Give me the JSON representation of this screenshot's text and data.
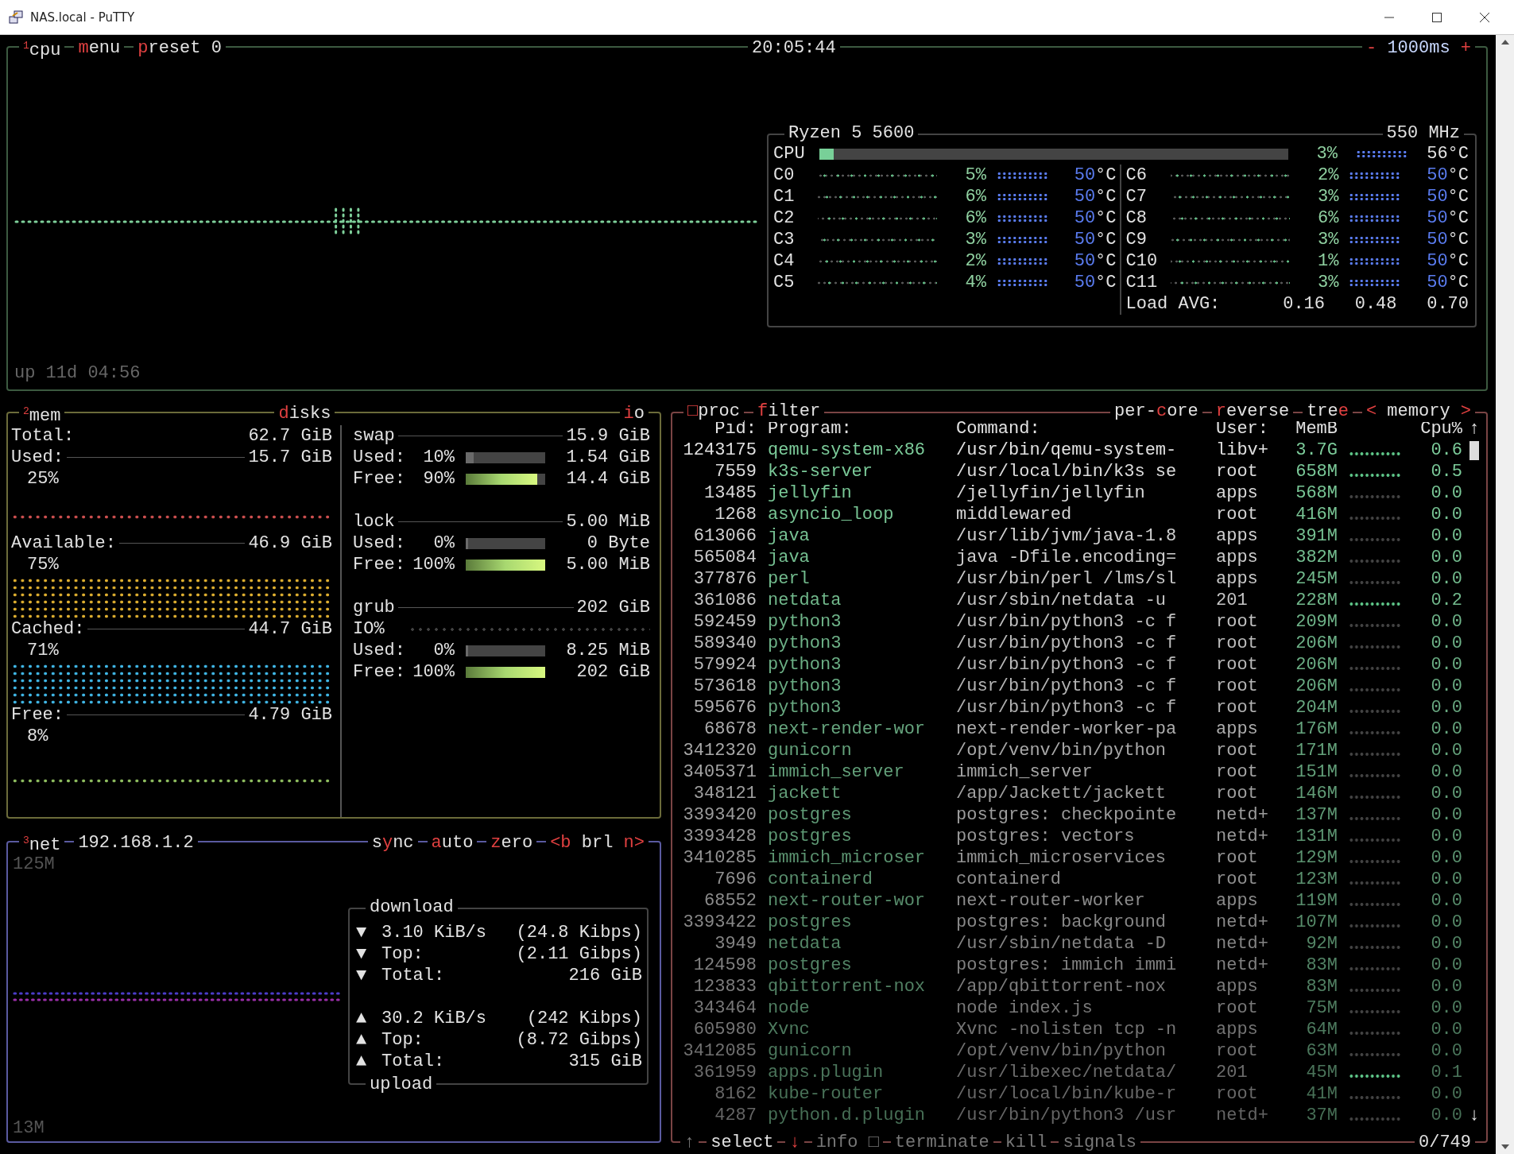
{
  "window": {
    "title": "NAS.local - PuTTY"
  },
  "cpu": {
    "tabs": [
      "$^{1}$cpu",
      "**m**enu",
      "**p**reset 0"
    ],
    "clock": "20:05:44",
    "interval": "**-** 1000ms **+**",
    "uptime": "up 11d 04:56",
    "info": {
      "model": "Ryzen 5 5600",
      "frequency": "550 MHz",
      "total": {
        "label": "CPU",
        "level": 0.03,
        "percent": "3%",
        "temp": "56°C"
      },
      "cores": [
        {
          "name": "C0",
          "percent": "5%",
          "temp": "**50**°C"
        },
        {
          "name": "C1",
          "percent": "6%",
          "temp": "**50**°C"
        },
        {
          "name": "C2",
          "percent": "6%",
          "temp": "**50**°C"
        },
        {
          "name": "C3",
          "percent": "3%",
          "temp": "**50**°C"
        },
        {
          "name": "C4",
          "percent": "2%",
          "temp": "**50**°C"
        },
        {
          "name": "C5",
          "percent": "4%",
          "temp": "**50**°C"
        },
        {
          "name": "C6",
          "percent": "2%",
          "temp": "**50**°C"
        },
        {
          "name": "C7",
          "percent": "3%",
          "temp": "**50**°C"
        },
        {
          "name": "C8",
          "percent": "6%",
          "temp": "**50**°C"
        },
        {
          "name": "C9",
          "percent": "3%",
          "temp": "**50**°C"
        },
        {
          "name": "C10",
          "percent": "1%",
          "temp": "**50**°C"
        },
        {
          "name": "C11",
          "percent": "3%",
          "temp": "**50**°C"
        }
      ],
      "load": {
        "label": "Load AVG:",
        "values": [
          "0.16",
          "0.48",
          "0.70"
        ]
      }
    }
  },
  "mem": {
    "title": "$^{2}$mem",
    "total": {
      "label": "Total:",
      "value": "62.7 GiB"
    },
    "meters": [
      {
        "label": "Used:",
        "value": "15.7 GiB",
        "percent": "25%",
        "color": "#d05050"
      },
      {
        "label": "Available:",
        "value": "46.9 GiB",
        "percent": "75%",
        "color": "#e0b030"
      },
      {
        "label": "Cached:",
        "value": "44.7 GiB",
        "percent": "71%",
        "color": "#40b8e8"
      },
      {
        "label": "Free:",
        "value": "4.79 GiB",
        "percent": "8%",
        "color": "#90c060"
      }
    ],
    "disks_title": "**d**isks",
    "io_title": "**i**o",
    "disks": [
      {
        "name": "swap",
        "size": "15.9 GiB",
        "used": {
          "label": "Used:",
          "percent": "10%",
          "level": 0.1,
          "value": "1.54 GiB"
        },
        "free": {
          "label": "Free:",
          "percent": "90%",
          "level": 0.9,
          "value": "14.4 GiB"
        }
      },
      {
        "name": "lock",
        "size": "5.00 MiB",
        "used": {
          "label": "Used:",
          "percent": "0%",
          "level": 0,
          "value": "0 Byte"
        },
        "free": {
          "label": "Free:",
          "percent": "100%",
          "level": 1,
          "value": "5.00 MiB"
        }
      },
      {
        "name": "grub",
        "size": "202 GiB",
        "io_label": "IO%",
        "used": {
          "label": "Used:",
          "percent": "0%",
          "level": 0,
          "value": "8.25 MiB"
        },
        "free": {
          "label": "Free:",
          "percent": "100%",
          "level": 1,
          "value": "202 GiB"
        }
      }
    ]
  },
  "net": {
    "title": "$^{3}$net",
    "address": "192.168.1.2",
    "toggles": [
      "s**y**nc",
      "**a**uto",
      "**z**ero",
      "**<b** brl **n>**"
    ],
    "scale_top": "125M",
    "scale_bottom": "13M",
    "download": {
      "title": "download",
      "rows": [
        {
          "arrow": "▼",
          "label": "3.10 KiB/s",
          "value": "(24.8 Kibps)"
        },
        {
          "arrow": "▼",
          "label": "Top:",
          "value": "(2.11 Gibps)"
        },
        {
          "arrow": "▼",
          "label": "Total:",
          "value": "216 GiB"
        }
      ]
    },
    "upload": {
      "title": "upload",
      "rows": [
        {
          "arrow": "▲",
          "label": "30.2 KiB/s",
          "value": "(242 Kibps)"
        },
        {
          "arrow": "▲",
          "label": "Top:",
          "value": "(8.72 Gibps)"
        },
        {
          "arrow": "▲",
          "label": "Total:",
          "value": "315 GiB"
        }
      ]
    }
  },
  "proc": {
    "tabs_left": [
      "**□**proc",
      "**f**ilter"
    ],
    "tabs_right": [
      "per-**c**ore",
      "**r**everse",
      "tre**e**",
      "**<** memory **>**"
    ],
    "columns": [
      "Pid:",
      "Program:",
      "Command:",
      "User:",
      "MemB",
      "Cpu%"
    ],
    "rows": [
      {
        "pid": "1243175",
        "program": "qemu-system-x86",
        "command": "/usr/bin/qemu-system-",
        "user": "libv+",
        "memory": "3.7G",
        "cpu": "0.6"
      },
      {
        "pid": "7559",
        "program": "k3s-server",
        "command": "/usr/local/bin/k3s se",
        "user": "root",
        "memory": "658M",
        "cpu": "0.5"
      },
      {
        "pid": "13485",
        "program": "jellyfin",
        "command": "/jellyfin/jellyfin",
        "user": "apps",
        "memory": "568M",
        "cpu": "0.0"
      },
      {
        "pid": "1268",
        "program": "asyncio_loop",
        "command": "middlewared",
        "user": "root",
        "memory": "416M",
        "cpu": "0.0"
      },
      {
        "pid": "613066",
        "program": "java",
        "command": "/usr/lib/jvm/java-1.8",
        "user": "apps",
        "memory": "391M",
        "cpu": "0.0"
      },
      {
        "pid": "565084",
        "program": "java",
        "command": "java -Dfile.encoding=",
        "user": "apps",
        "memory": "382M",
        "cpu": "0.0"
      },
      {
        "pid": "377876",
        "program": "perl",
        "command": "/usr/bin/perl /lms/sl",
        "user": "apps",
        "memory": "245M",
        "cpu": "0.0"
      },
      {
        "pid": "361086",
        "program": "netdata",
        "command": "/usr/sbin/netdata -u",
        "user": "201",
        "memory": "228M",
        "cpu": "0.2"
      },
      {
        "pid": "592459",
        "program": "python3",
        "command": "/usr/bin/python3 -c f",
        "user": "root",
        "memory": "209M",
        "cpu": "0.0"
      },
      {
        "pid": "589340",
        "program": "python3",
        "command": "/usr/bin/python3 -c f",
        "user": "root",
        "memory": "206M",
        "cpu": "0.0"
      },
      {
        "pid": "579924",
        "program": "python3",
        "command": "/usr/bin/python3 -c f",
        "user": "root",
        "memory": "206M",
        "cpu": "0.0"
      },
      {
        "pid": "573618",
        "program": "python3",
        "command": "/usr/bin/python3 -c f",
        "user": "root",
        "memory": "206M",
        "cpu": "0.0"
      },
      {
        "pid": "595676",
        "program": "python3",
        "command": "/usr/bin/python3 -c f",
        "user": "root",
        "memory": "204M",
        "cpu": "0.0"
      },
      {
        "pid": "68678",
        "program": "next-render-wor",
        "command": "next-render-worker-pa",
        "user": "apps",
        "memory": "176M",
        "cpu": "0.0"
      },
      {
        "pid": "3412320",
        "program": "gunicorn",
        "command": "/opt/venv/bin/python",
        "user": "root",
        "memory": "171M",
        "cpu": "0.0"
      },
      {
        "pid": "3405371",
        "program": "immich_server",
        "command": "immich_server",
        "user": "root",
        "memory": "151M",
        "cpu": "0.0"
      },
      {
        "pid": "348121",
        "program": "jackett",
        "command": "/app/Jackett/jackett",
        "user": "root",
        "memory": "146M",
        "cpu": "0.0"
      },
      {
        "pid": "3393420",
        "program": "postgres",
        "command": "postgres: checkpointe",
        "user": "netd+",
        "memory": "137M",
        "cpu": "0.0"
      },
      {
        "pid": "3393428",
        "program": "postgres",
        "command": "postgres: vectors",
        "user": "netd+",
        "memory": "131M",
        "cpu": "0.0"
      },
      {
        "pid": "3410285",
        "program": "immich_microser",
        "command": "immich_microservices",
        "user": "root",
        "memory": "129M",
        "cpu": "0.0"
      },
      {
        "pid": "7696",
        "program": "containerd",
        "command": "containerd",
        "user": "root",
        "memory": "123M",
        "cpu": "0.0"
      },
      {
        "pid": "68552",
        "program": "next-router-wor",
        "command": "next-router-worker",
        "user": "apps",
        "memory": "119M",
        "cpu": "0.0"
      },
      {
        "pid": "3393422",
        "program": "postgres",
        "command": "postgres: background",
        "user": "netd+",
        "memory": "107M",
        "cpu": "0.0"
      },
      {
        "pid": "3949",
        "program": "netdata",
        "command": "/usr/sbin/netdata -D",
        "user": "netd+",
        "memory": "92M",
        "cpu": "0.0"
      },
      {
        "pid": "124598",
        "program": "postgres",
        "command": "postgres: immich immi",
        "user": "netd+",
        "memory": "83M",
        "cpu": "0.0"
      },
      {
        "pid": "123833",
        "program": "qbittorrent-nox",
        "command": "/app/qbittorrent-nox",
        "user": "apps",
        "memory": "83M",
        "cpu": "0.0"
      },
      {
        "pid": "343464",
        "program": "node",
        "command": "node index.js",
        "user": "root",
        "memory": "75M",
        "cpu": "0.0"
      },
      {
        "pid": "605980",
        "program": "Xvnc",
        "command": "Xvnc -nolisten tcp -n",
        "user": "apps",
        "memory": "64M",
        "cpu": "0.0"
      },
      {
        "pid": "3412085",
        "program": "gunicorn",
        "command": "/opt/venv/bin/python",
        "user": "root",
        "memory": "63M",
        "cpu": "0.0"
      },
      {
        "pid": "361959",
        "program": "apps.plugin",
        "command": "/usr/libexec/netdata/",
        "user": "201",
        "memory": "45M",
        "cpu": "0.1"
      },
      {
        "pid": "8162",
        "program": "kube-router",
        "command": "/usr/local/bin/kube-r",
        "user": "root",
        "memory": "41M",
        "cpu": "0.0"
      },
      {
        "pid": "4287",
        "program": "python.d.plugin",
        "command": "/usr/bin/python3 /usr",
        "user": "netd+",
        "memory": "37M",
        "cpu": "0.0"
      }
    ],
    "scroll_up": "↑",
    "scroll_down": "↓",
    "footer": {
      "up": "↑",
      "select": "select",
      "down": "↓",
      "actions": [
        "info □",
        "terminate",
        "kill",
        "signals"
      ],
      "count": "0/749"
    }
  }
}
